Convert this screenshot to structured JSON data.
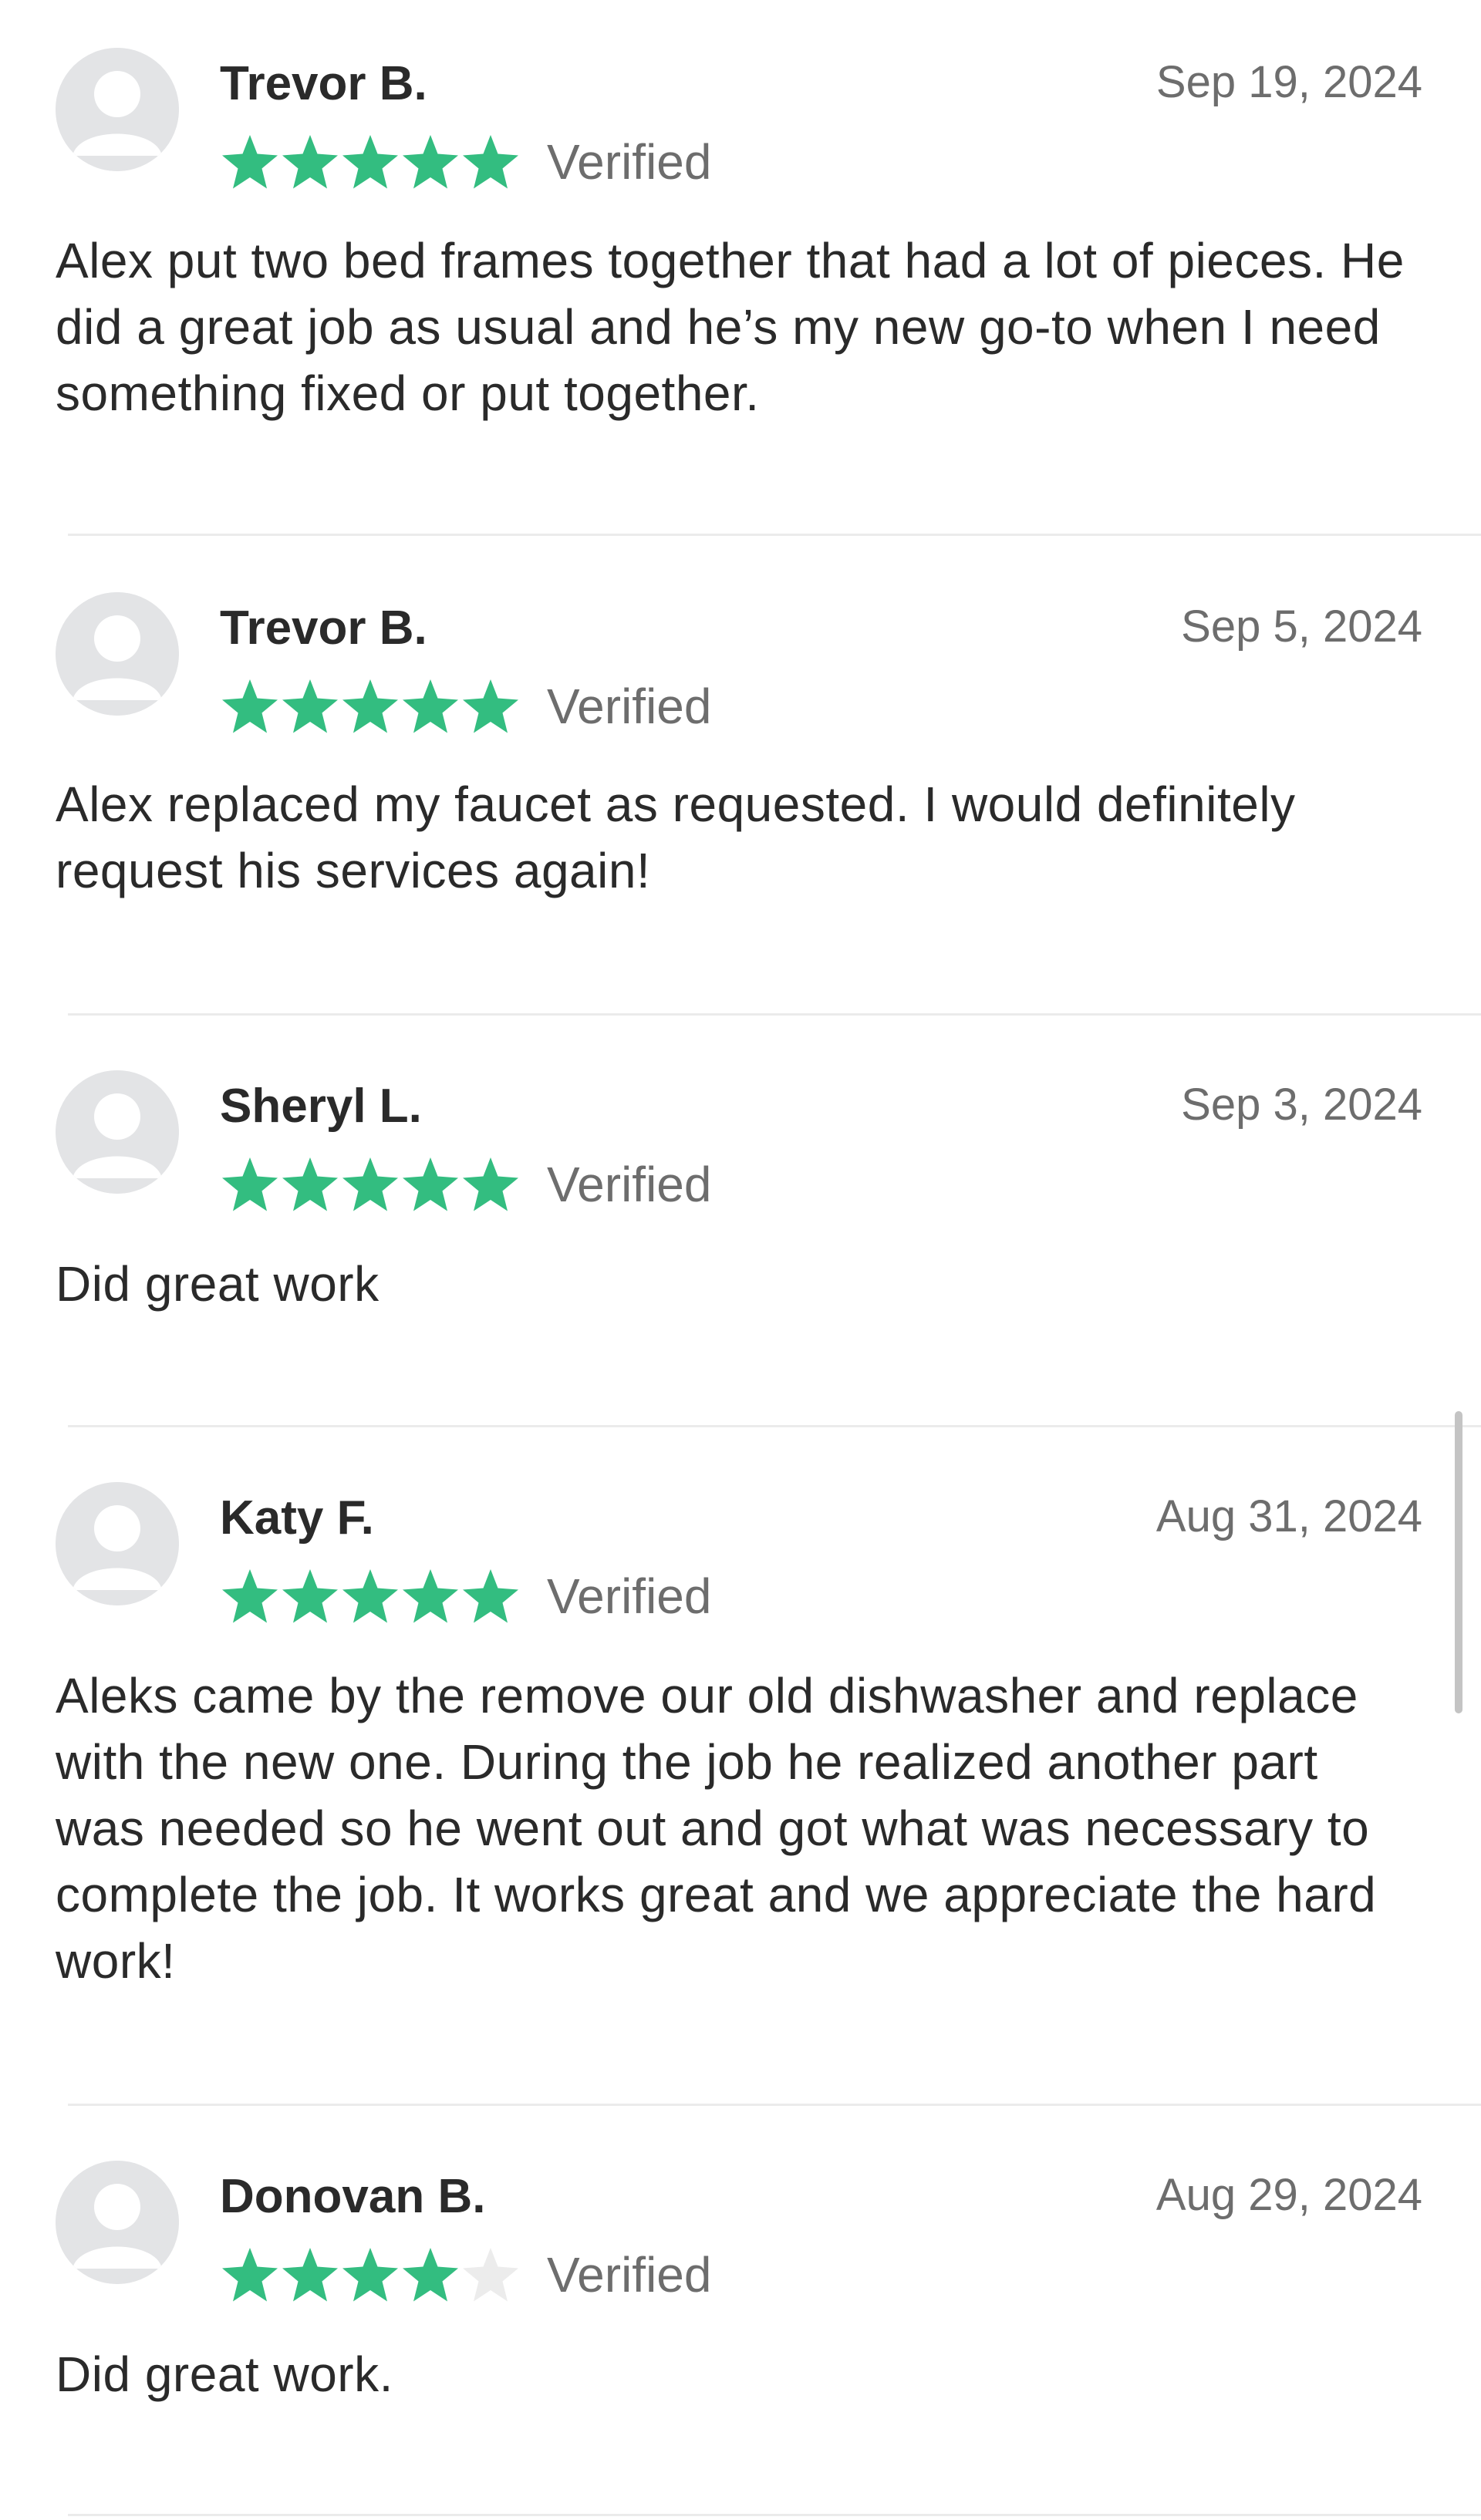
{
  "reviews": [
    {
      "name": "Trevor B.",
      "date": "Sep 19, 2024",
      "rating": 5,
      "verified_label": "Verified",
      "text": "Alex put two bed frames together that had a lot of pieces. He did a great job as usual and he’s my new go-to when I need something fixed or put together."
    },
    {
      "name": "Trevor B.",
      "date": "Sep 5, 2024",
      "rating": 5,
      "verified_label": "Verified",
      "text": "Alex replaced my faucet as requested. I would definitely request his services again!"
    },
    {
      "name": "Sheryl L.",
      "date": "Sep 3, 2024",
      "rating": 5,
      "verified_label": "Verified",
      "text": "Did great work"
    },
    {
      "name": "Katy F.",
      "date": "Aug 31, 2024",
      "rating": 5,
      "verified_label": "Verified",
      "text": "Aleks came by the remove our old dishwasher and replace with the new one. During the job he realized another part was needed so he went out and got what was necessary to complete the job. It works great and we appreciate the hard work!"
    },
    {
      "name": "Donovan B.",
      "date": "Aug 29, 2024",
      "rating": 4,
      "verified_label": "Verified",
      "text": "Did great work."
    }
  ],
  "colors": {
    "star_filled": "#33bd80",
    "star_empty": "#ececec",
    "avatar_bg": "#e3e4e6",
    "avatar_fg": "#ffffff"
  },
  "icons": {
    "avatar": "default-user-avatar-icon",
    "star": "star-icon"
  }
}
